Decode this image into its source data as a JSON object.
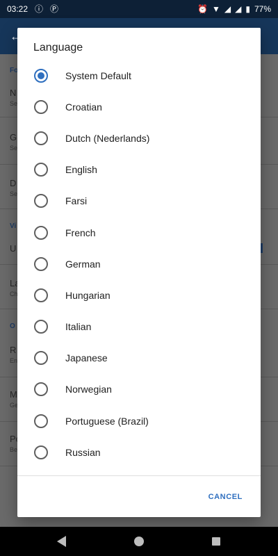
{
  "status_bar": {
    "time": "03:22",
    "icons_left": [
      "alert-circle-icon",
      "p-icon"
    ],
    "icons_right": [
      "alarm-icon",
      "wifi-icon",
      "signal-icon",
      "signal-icon-2"
    ],
    "battery_percent": "77%"
  },
  "dialog": {
    "title": "Language",
    "selected": "System Default",
    "options": [
      {
        "label": "System Default",
        "checked": true
      },
      {
        "label": "Croatian",
        "checked": false
      },
      {
        "label": "Dutch (Nederlands)",
        "checked": false
      },
      {
        "label": "English",
        "checked": false
      },
      {
        "label": "Farsi",
        "checked": false
      },
      {
        "label": "French",
        "checked": false
      },
      {
        "label": "German",
        "checked": false
      },
      {
        "label": "Hungarian",
        "checked": false
      },
      {
        "label": "Italian",
        "checked": false
      },
      {
        "label": "Japanese",
        "checked": false
      },
      {
        "label": "Norwegian",
        "checked": false
      },
      {
        "label": "Portuguese (Brazil)",
        "checked": false
      },
      {
        "label": "Russian",
        "checked": false
      }
    ],
    "cancel_label": "CANCEL"
  },
  "colors": {
    "accent": "#2f6fbf",
    "app_bar": "#16365a",
    "status_bar": "#0d2036"
  }
}
